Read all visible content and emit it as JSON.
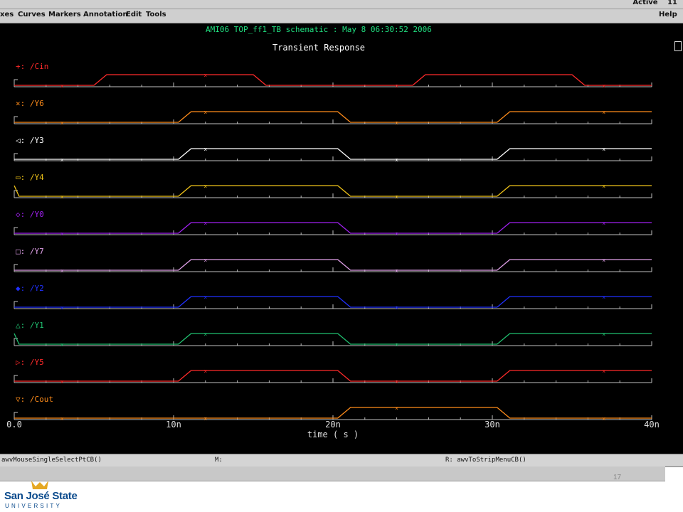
{
  "status": {
    "state": "Active",
    "number": "11"
  },
  "menu": {
    "items": [
      "xes",
      "Curves",
      "Markers",
      "Annotation",
      "Edit",
      "Tools"
    ],
    "help": "Help"
  },
  "plot": {
    "header": "AMI06 TOP_ff1_TB schematic : May  8 06:30:52 2006",
    "title": "Transient Response",
    "xlabel": "time ( s )"
  },
  "chart_data": {
    "type": "line",
    "title": "Transient Response",
    "xlabel": "time ( s )",
    "xlim": [
      0,
      40
    ],
    "x_unit": "ns",
    "x_ticks": [
      "0.0",
      "10n",
      "20n",
      "30n",
      "40n"
    ],
    "series": [
      {
        "name": "/Cin",
        "marker": "+",
        "color": "#ff2a2a",
        "edges": [
          5.0,
          15.0,
          25.0,
          35.0
        ],
        "initial": 0
      },
      {
        "name": "/Y6",
        "marker": "×",
        "color": "#ff8c1a",
        "edges": [
          10.3,
          20.3,
          30.3
        ],
        "initial": 0
      },
      {
        "name": "/Y3",
        "marker": "◁",
        "color": "#ffffff",
        "edges": [
          10.3,
          20.3,
          30.3
        ],
        "initial": 0
      },
      {
        "name": "/Y4",
        "marker": "▭",
        "color": "#f0c419",
        "edges": [
          10.3,
          20.3,
          30.3
        ],
        "initial": 1,
        "initial_fall": 0.3
      },
      {
        "name": "/Y0",
        "marker": "◇",
        "color": "#a020f0",
        "edges": [
          10.3,
          20.3,
          30.3
        ],
        "initial": 0
      },
      {
        "name": "/Y7",
        "marker": "□",
        "color": "#e0a0e8",
        "edges": [
          10.3,
          20.3,
          30.3
        ],
        "initial": 0
      },
      {
        "name": "/Y2",
        "marker": "◆",
        "color": "#2030ff",
        "edges": [
          10.3,
          20.3,
          30.3
        ],
        "initial": 0
      },
      {
        "name": "/Y1",
        "marker": "△",
        "color": "#20c070",
        "edges": [
          10.3,
          20.3,
          30.3
        ],
        "initial": 1,
        "initial_fall": 0.3
      },
      {
        "name": "/Y5",
        "marker": "▷",
        "color": "#ff2a2a",
        "edges": [
          10.3,
          20.3,
          30.3
        ],
        "initial": 0
      },
      {
        "name": "/Cout",
        "marker": "▽",
        "color": "#ff8c1a",
        "edges": [
          20.3,
          30.3
        ],
        "initial": 0
      }
    ]
  },
  "cmd": {
    "left": "awvMouseSingleSelectPtCB()",
    "mid": "M:",
    "right": "R: awvToStripMenuCB()"
  },
  "footer": {
    "page_number": "17",
    "logo_name": "San José State",
    "logo_sub": "UNIVERSITY"
  },
  "colors": {
    "background": "#000000",
    "axis": "#c0c0c0",
    "header": "#20e080",
    "logo": "#0a4a8c",
    "logo_gold": "#e5a823"
  }
}
